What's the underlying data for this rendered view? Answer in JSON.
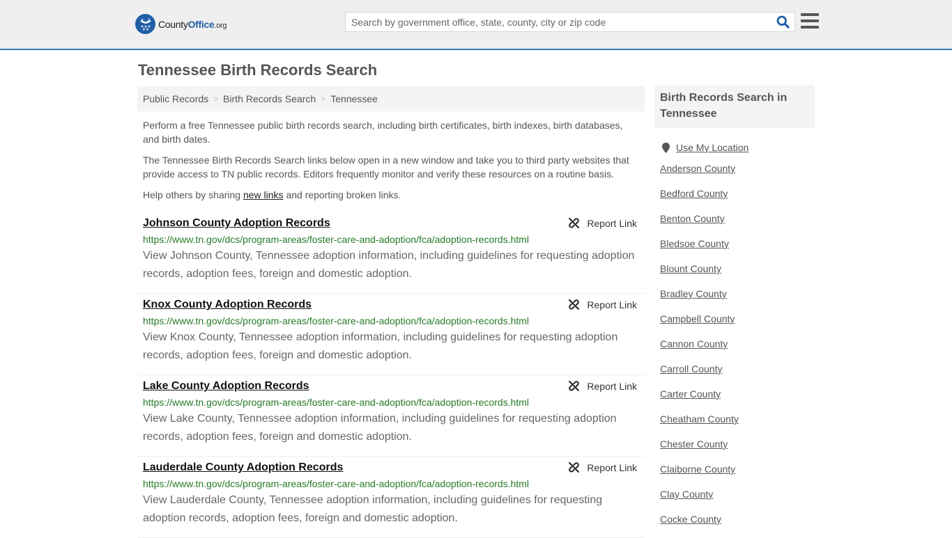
{
  "header": {
    "logo": {
      "text_main": "County",
      "text_accent": "Office",
      "text_suffix": ".org",
      "icon": "eagle-stars-badge-icon"
    },
    "search": {
      "placeholder": "Search by government office, state, county, city or zip code",
      "value": "",
      "icon": "search-icon"
    },
    "menu_icon": "hamburger-menu-icon"
  },
  "colors": {
    "brand_blue": "#1f5fa8",
    "header_border": "#3a7ab5",
    "url_green": "#277a27",
    "header_bg": "#efefef",
    "panel_bg": "#f4f4f4"
  },
  "page": {
    "title": "Tennessee Birth Records Search"
  },
  "breadcrumb": [
    {
      "label": "Public Records"
    },
    {
      "label": "Birth Records Search"
    },
    {
      "label": "Tennessee"
    }
  ],
  "intro": {
    "p1": "Perform a free Tennessee public birth records search, including birth certificates, birth indexes, birth databases, and birth dates.",
    "p2": "The Tennessee Birth Records Search links below open in a new window and take you to third party websites that provide access to TN public records. Editors frequently monitor and verify these resources on a routine basis.",
    "p3_before": "Help others by sharing ",
    "p3_link": "new links",
    "p3_after": " and reporting broken links."
  },
  "results": [
    {
      "title": "Johnson County Adoption Records",
      "url": "https://www.tn.gov/dcs/program-areas/foster-care-and-adoption/fca/adoption-records.html",
      "description": "View Johnson County, Tennessee adoption information, including guidelines for requesting adoption records, adoption fees, foreign and domestic adoption.",
      "report_label": "Report Link"
    },
    {
      "title": "Knox County Adoption Records",
      "url": "https://www.tn.gov/dcs/program-areas/foster-care-and-adoption/fca/adoption-records.html",
      "description": "View Knox County, Tennessee adoption information, including guidelines for requesting adoption records, adoption fees, foreign and domestic adoption.",
      "report_label": "Report Link"
    },
    {
      "title": "Lake County Adoption Records",
      "url": "https://www.tn.gov/dcs/program-areas/foster-care-and-adoption/fca/adoption-records.html",
      "description": "View Lake County, Tennessee adoption information, including guidelines for requesting adoption records, adoption fees, foreign and domestic adoption.",
      "report_label": "Report Link"
    },
    {
      "title": "Lauderdale County Adoption Records",
      "url": "https://www.tn.gov/dcs/program-areas/foster-care-and-adoption/fca/adoption-records.html",
      "description": "View Lauderdale County, Tennessee adoption information, including guidelines for requesting adoption records, adoption fees, foreign and domestic adoption.",
      "report_label": "Report Link"
    }
  ],
  "sidebar": {
    "title": "Birth Records Search in Tennessee",
    "use_location_label": "Use My Location",
    "counties": [
      "Anderson County",
      "Bedford County",
      "Benton County",
      "Bledsoe County",
      "Blount County",
      "Bradley County",
      "Campbell County",
      "Cannon County",
      "Carroll County",
      "Carter County",
      "Cheatham County",
      "Chester County",
      "Claiborne County",
      "Clay County",
      "Cocke County"
    ]
  }
}
